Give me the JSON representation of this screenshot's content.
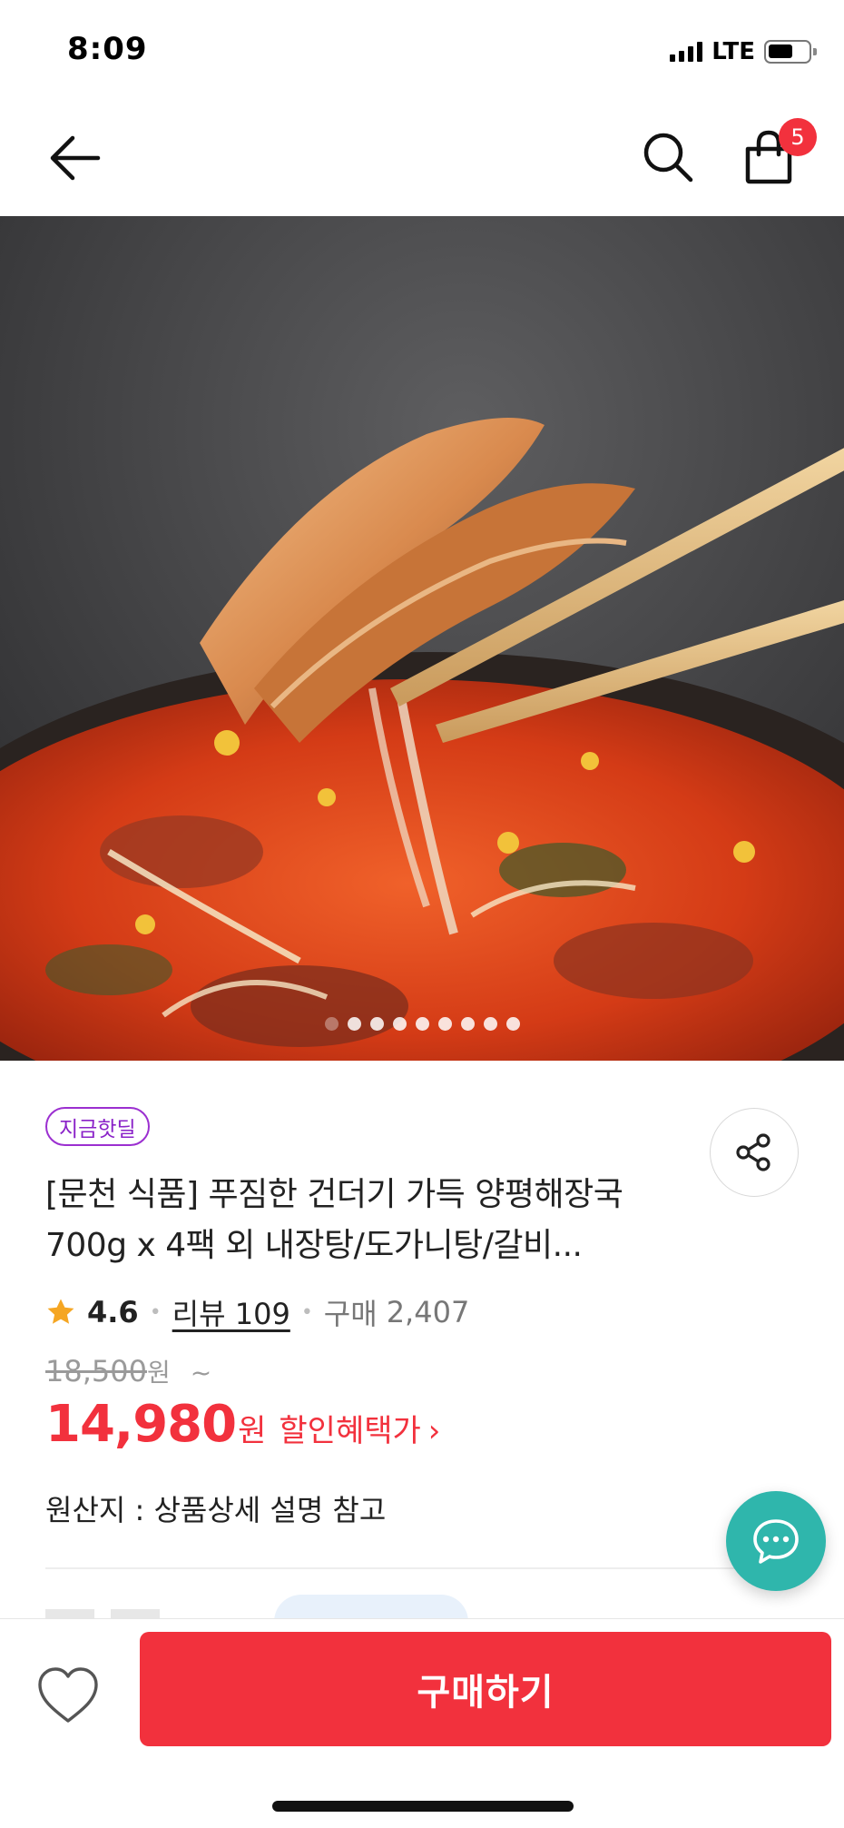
{
  "status_bar": {
    "time": "8:09",
    "network": "LTE",
    "battery_level": 0.55
  },
  "nav": {
    "back_icon": "arrow-left-icon",
    "search_icon": "search-icon",
    "cart_icon": "shopping-bag-icon",
    "cart_badge": "5"
  },
  "gallery": {
    "image_subject": "spicy beef soup with meat lifted by chopsticks",
    "total_images": 9,
    "active_index": 0
  },
  "product": {
    "badge": "지금핫딜",
    "title": "[문천 식품] 푸짐한 건더기 가득 양평해장국 700g x 4팩 외 내장탕/도가니탕/갈비...",
    "rating": "4.6",
    "review_link": "리뷰 109",
    "purchase_label": "구매",
    "purchase_count": "2,407",
    "original_price": "18,500",
    "original_price_unit": "원",
    "range_suffix": "~",
    "sale_price": "14,980",
    "sale_price_unit": "원",
    "discount_label": "할인혜택가",
    "discount_chevron": "›",
    "origin": "원산지 : 상품상세 설명 참고"
  },
  "bottom_bar": {
    "wishlist_icon": "heart-outline-icon",
    "buy_label": "구매하기"
  },
  "colors": {
    "accent_red": "#f2313d",
    "badge_purple": "#8a22c8",
    "chat_teal": "#2fb6ac",
    "star_yellow": "#f5a623"
  }
}
